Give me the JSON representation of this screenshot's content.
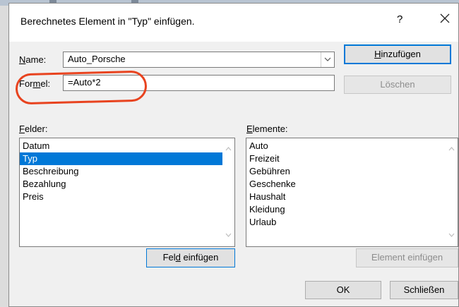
{
  "dialog": {
    "title": "Berechnetes Element in \"Typ\" einfügen.",
    "help_label": "?",
    "close_icon": "close-icon"
  },
  "name_field": {
    "label_prefix": "N",
    "label_rest": "ame:",
    "value": "Auto_Porsche"
  },
  "formula_field": {
    "label_prefix": "For",
    "label_u": "m",
    "label_rest": "el:",
    "value": "=Auto*2"
  },
  "buttons": {
    "add_u": "H",
    "add_rest": "inzufügen",
    "delete": "Löschen",
    "insert_field_pre": "Fel",
    "insert_field_u": "d",
    "insert_field_rest": " einfügen",
    "insert_element": "Element einfügen",
    "ok": "OK",
    "close": "Schließen"
  },
  "fields": {
    "label_u": "F",
    "label_rest": "elder:",
    "items": [
      "Datum",
      "Typ",
      "Beschreibung",
      "Bezahlung",
      "Preis"
    ],
    "selected": "Typ"
  },
  "elements": {
    "label_u": "E",
    "label_rest": "lemente:",
    "items": [
      "Auto",
      "Freizeit",
      "Gebühren",
      "Geschenke",
      "Haushalt",
      "Kleidung",
      "Urlaub"
    ]
  },
  "colors": {
    "selection": "#0078d7",
    "annotation": "#e8431f",
    "default_button_border": "#0078d7"
  }
}
